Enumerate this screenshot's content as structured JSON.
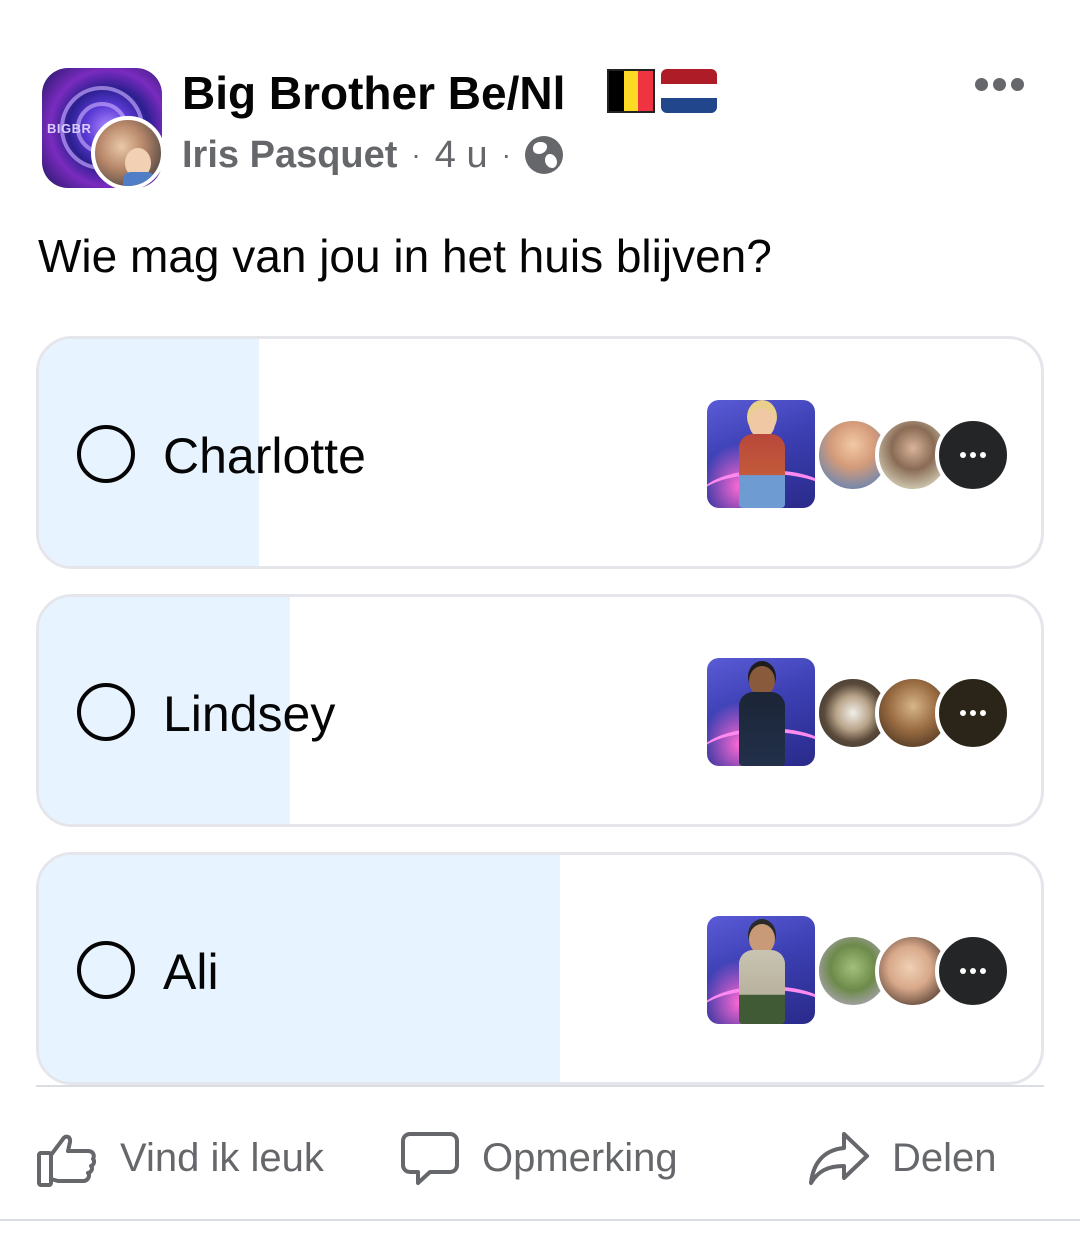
{
  "post": {
    "group_name": "Big Brother Be/Nl",
    "group_avatar_text": "BIGBR",
    "author": "Iris Pasquet",
    "separator": "·",
    "time": "4 u",
    "privacy_icon": "globe-icon",
    "question": "Wie mag van jou in het huis blijven?"
  },
  "poll": {
    "options": [
      {
        "label": "Charlotte",
        "vote_share": 0.22
      },
      {
        "label": "Lindsey",
        "vote_share": 0.25
      },
      {
        "label": "Ali",
        "vote_share": 0.52
      }
    ]
  },
  "actions": {
    "like_label": "Vind ik leuk",
    "comment_label": "Opmerking",
    "share_label": "Delen"
  },
  "colors": {
    "poll_fill": "#e7f3ff",
    "secondary_text": "#65676b",
    "flag_be": [
      "#000000",
      "#fdda24",
      "#ef3340"
    ],
    "flag_nl": [
      "#ae1c28",
      "#ffffff",
      "#21468b"
    ]
  }
}
